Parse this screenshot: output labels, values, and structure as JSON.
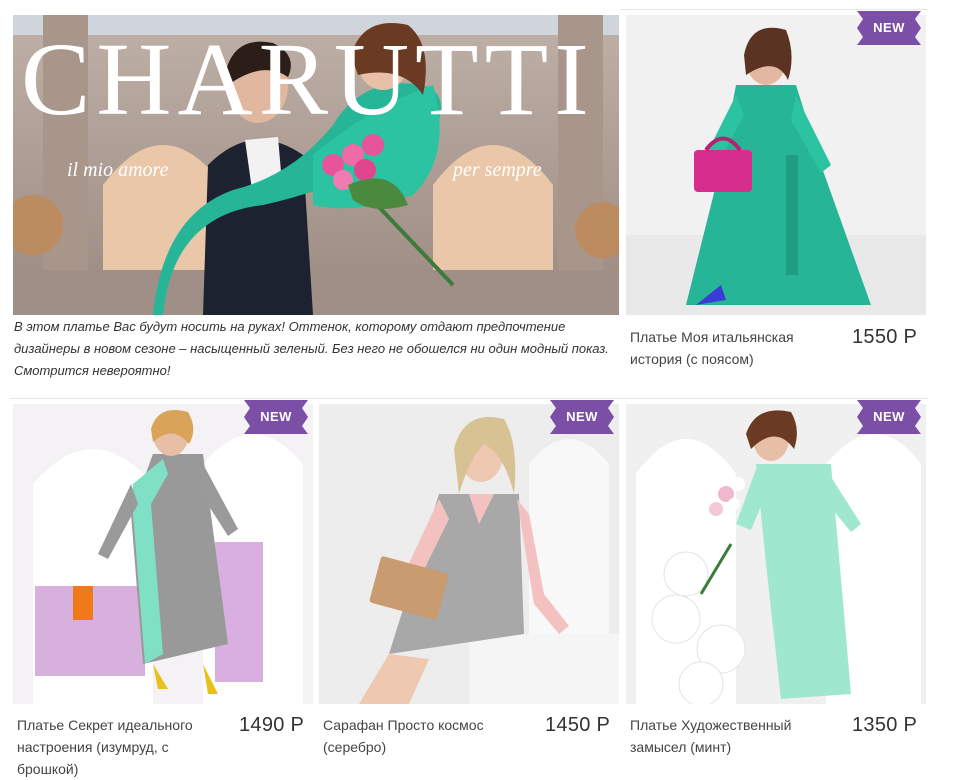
{
  "banner": {
    "brand": "CHARUTTI",
    "tagline_left": "il mio amore",
    "tagline_right": "per sempre",
    "caption": "В этом платье Вас будут носить на руках! Оттенок, которому отдают предпочтение дизайнеры в новом сезоне – насыщенный зеленый. Без него не обошелся ни один модный показ. Смотрится невероятно!"
  },
  "badge_label": "NEW",
  "colors": {
    "badge": "#7b4fa6",
    "emerald": "#26b597",
    "mint": "#9fe8cf",
    "grey_dress": "#9a9a9a",
    "pink": "#f3c2c0",
    "lilac": "#d9aee0"
  },
  "products": [
    {
      "name": "Платье Моя итальянская история (с поясом)",
      "price": "1550 Р",
      "new": true
    },
    {
      "name": "Платье Секрет идеального настроения (изумруд, с брошкой)",
      "price": "1490 Р",
      "new": true
    },
    {
      "name": "Сарафан Просто космос (серебро)",
      "price": "1450 Р",
      "new": true
    },
    {
      "name": "Платье Художественный замысел (минт)",
      "price": "1350 Р",
      "new": true
    }
  ]
}
